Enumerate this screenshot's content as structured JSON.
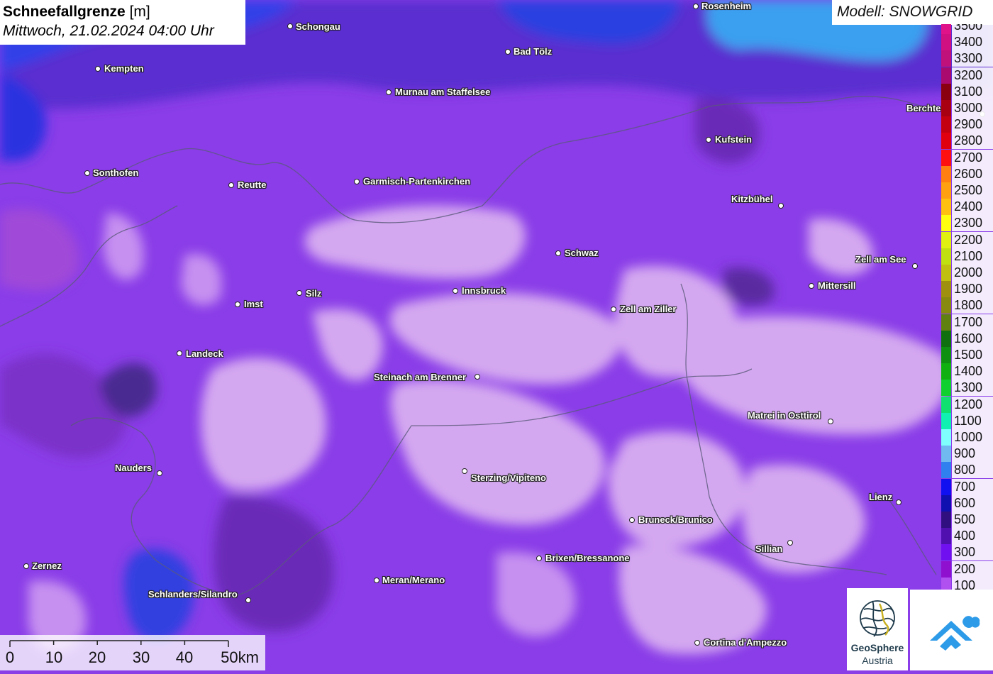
{
  "title": {
    "main": "Schneefallgrenze",
    "unit": "[m]",
    "datetime": "Mittwoch, 21.02.2024 04:00 Uhr"
  },
  "model_label": "Modell: SNOWGRID",
  "legend": {
    "entries": [
      {
        "label": "3500",
        "color": "#e0128a"
      },
      {
        "label": "3400",
        "color": "#d01080"
      },
      {
        "label": "3300",
        "color": "#c0107a"
      },
      {
        "label": "3200",
        "color": "#aa0a6e"
      },
      {
        "label": "3100",
        "color": "#8a0010"
      },
      {
        "label": "3000",
        "color": "#a80010"
      },
      {
        "label": "2900",
        "color": "#c40010"
      },
      {
        "label": "2800",
        "color": "#e00010"
      },
      {
        "label": "2700",
        "color": "#ff1010"
      },
      {
        "label": "2600",
        "color": "#ff8010"
      },
      {
        "label": "2500",
        "color": "#ffa010"
      },
      {
        "label": "2400",
        "color": "#ffc010"
      },
      {
        "label": "2300",
        "color": "#ffff10"
      },
      {
        "label": "2200",
        "color": "#e0f010"
      },
      {
        "label": "2100",
        "color": "#c0e010"
      },
      {
        "label": "2000",
        "color": "#c0c010"
      },
      {
        "label": "1900",
        "color": "#a09010"
      },
      {
        "label": "1800",
        "color": "#888a10"
      },
      {
        "label": "1700",
        "color": "#608010"
      },
      {
        "label": "1600",
        "color": "#107010"
      },
      {
        "label": "1500",
        "color": "#109010"
      },
      {
        "label": "1400",
        "color": "#10b010"
      },
      {
        "label": "1300",
        "color": "#10d030"
      },
      {
        "label": "1200",
        "color": "#10e070"
      },
      {
        "label": "1100",
        "color": "#10f0b0"
      },
      {
        "label": "1000",
        "color": "#80ffff"
      },
      {
        "label": "900",
        "color": "#70b8f0"
      },
      {
        "label": "800",
        "color": "#3080f0"
      },
      {
        "label": "700",
        "color": "#1010f0"
      },
      {
        "label": "600",
        "color": "#1010b0"
      },
      {
        "label": "500",
        "color": "#301080"
      },
      {
        "label": "400",
        "color": "#5010b0"
      },
      {
        "label": "300",
        "color": "#7010f0"
      },
      {
        "label": "200",
        "color": "#9010d0"
      },
      {
        "label": "100",
        "color": "#b050f0"
      }
    ]
  },
  "cities": [
    {
      "name": "Rosenheim"
    },
    {
      "name": "Schongau"
    },
    {
      "name": "Kempten"
    },
    {
      "name": "Bad Tölz"
    },
    {
      "name": "Murnau am Staffelsee"
    },
    {
      "name": "Berchte"
    },
    {
      "name": "Kufstein"
    },
    {
      "name": "Sonthofen"
    },
    {
      "name": "Reutte"
    },
    {
      "name": "Garmisch-Partenkirchen"
    },
    {
      "name": "Kitzbühel"
    },
    {
      "name": "Schwaz"
    },
    {
      "name": "Zell am See"
    },
    {
      "name": "Silz"
    },
    {
      "name": "Innsbruck"
    },
    {
      "name": "Mittersill"
    },
    {
      "name": "Imst"
    },
    {
      "name": "Zell am Ziller"
    },
    {
      "name": "Landeck"
    },
    {
      "name": "Steinach am Brenner"
    },
    {
      "name": "Matrei in Osttirol"
    },
    {
      "name": "Nauders"
    },
    {
      "name": "Sterzing/Vipiteno"
    },
    {
      "name": "Lienz"
    },
    {
      "name": "Bruneck/Brunico"
    },
    {
      "name": "Sillian"
    },
    {
      "name": "Brixen/Bressanone"
    },
    {
      "name": "Zernez"
    },
    {
      "name": "Meran/Merano"
    },
    {
      "name": "Schlanders/Silandro"
    },
    {
      "name": "Cortina d'Ampezzo"
    }
  ],
  "scalebar": {
    "labels": [
      "0",
      "10",
      "20",
      "30",
      "40",
      "50km"
    ]
  },
  "logos": {
    "geosphere_line1": "GeoSphere",
    "geosphere_line2": "Austria"
  }
}
